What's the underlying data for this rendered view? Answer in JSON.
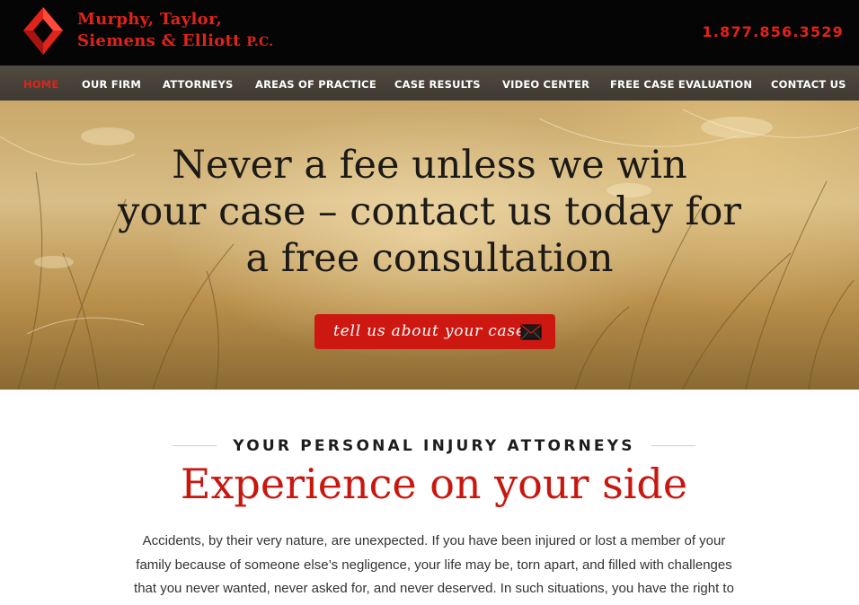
{
  "header": {
    "firm_name_line1": "Murphy, Taylor,",
    "firm_name_line2": "Siemens & Elliott",
    "firm_name_suffix": "P.C.",
    "phone": "1.877.856.3529",
    "logo_icon": "diamond-logo-icon"
  },
  "nav": {
    "items": [
      {
        "label": "HOME",
        "active": true
      },
      {
        "label": "OUR FIRM"
      },
      {
        "label": "ATTORNEYS"
      },
      {
        "label": "AREAS OF PRACTICE"
      },
      {
        "label": "CASE RESULTS"
      },
      {
        "label": "VIDEO CENTER"
      },
      {
        "label": "FREE CASE EVALUATION"
      },
      {
        "label": "CONTACT US"
      }
    ]
  },
  "hero": {
    "title_line1": "Never a fee unless we win",
    "title_line2": "your case – contact us today for",
    "title_line3": "a free consultation",
    "cta_label": "tell us about your case",
    "cta_icon": "envelope-icon"
  },
  "intro": {
    "kicker": "YOUR PERSONAL INJURY ATTORNEYS",
    "headline": "Experience on your side",
    "body_line1": "Accidents, by their very nature, are unexpected. If you have been injured or lost a member of your",
    "body_line2": "family because of someone else’s negligence, your life may be, torn apart, and filled with challenges",
    "body_line3": "that you never wanted, never asked for, and never deserved. In such situations, you have the right to"
  },
  "colors": {
    "brand_red": "#e0231b",
    "header_bg": "#050505",
    "nav_bg": "#4a443b"
  }
}
